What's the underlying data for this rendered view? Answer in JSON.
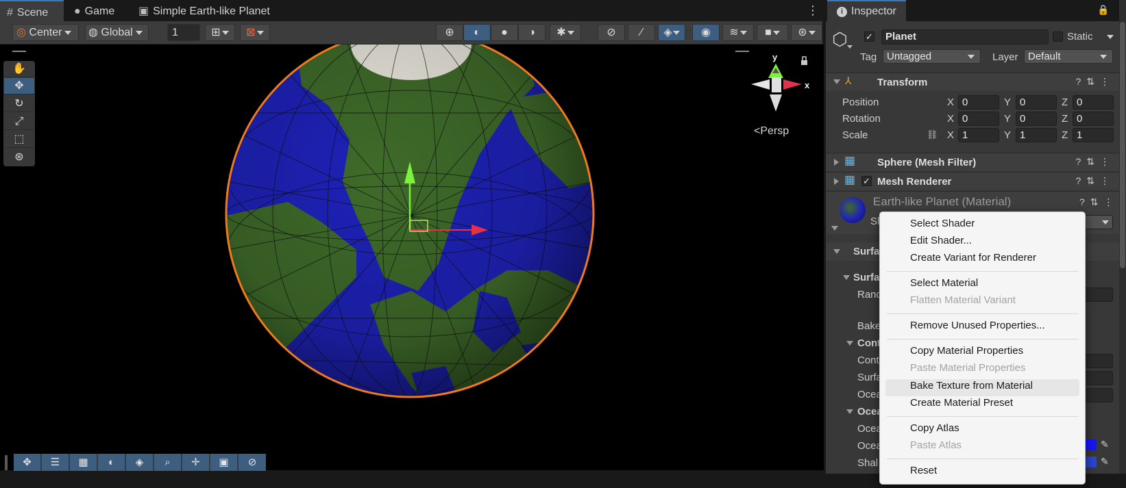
{
  "scene_tabs": {
    "scene": "Scene",
    "game": "Game",
    "document": "Simple Earth-like Planet"
  },
  "toolbar": {
    "pivot": "Center",
    "space": "Global",
    "grid_size": "1"
  },
  "viewport": {
    "gizmo_y": "y",
    "gizmo_x": "x",
    "projection": "Persp"
  },
  "inspector": {
    "tab": "Inspector",
    "object_name": "Planet",
    "static_label": "Static",
    "tag_label": "Tag",
    "tag_value": "Untagged",
    "layer_label": "Layer",
    "layer_value": "Default",
    "transform": {
      "title": "Transform",
      "position_label": "Position",
      "rotation_label": "Rotation",
      "scale_label": "Scale",
      "axis_x": "X",
      "axis_y": "Y",
      "axis_z": "Z",
      "position": [
        "0",
        "0",
        "0"
      ],
      "rotation": [
        "0",
        "0",
        "0"
      ],
      "scale": [
        "1",
        "1",
        "1"
      ]
    },
    "mesh_filter_title": "Sphere (Mesh Filter)",
    "mesh_renderer_title": "Mesh Renderer",
    "material_title": "Earth-like Planet (Material)",
    "clipped_labels": [
      "Sh",
      "Surfa",
      "Surfa",
      "Rand",
      "Bake",
      "Cont",
      "Cont",
      "Surfa",
      "Ocea",
      "Ocea",
      "Ocea",
      "Ocea",
      "Shal"
    ]
  },
  "context_menu": {
    "items": [
      {
        "label": "Select Shader",
        "enabled": true
      },
      {
        "label": "Edit Shader...",
        "enabled": true
      },
      {
        "label": "Create Variant for Renderer",
        "enabled": true
      },
      {
        "label": "Select Material",
        "enabled": true
      },
      {
        "label": "Flatten Material Variant",
        "enabled": false
      },
      {
        "label": "Remove Unused Properties...",
        "enabled": true
      },
      {
        "label": "Copy Material Properties",
        "enabled": true
      },
      {
        "label": "Paste Material Properties",
        "enabled": false
      },
      {
        "label": "Bake Texture from Material",
        "enabled": true
      },
      {
        "label": "Create Material Preset",
        "enabled": true
      },
      {
        "label": "Copy Atlas",
        "enabled": true
      },
      {
        "label": "Paste Atlas",
        "enabled": false
      },
      {
        "label": "Reset",
        "enabled": true
      }
    ]
  },
  "colors": {
    "accent": "#3a79bb",
    "active_button": "#3e5e80",
    "ocean": "#1e22b8",
    "land": "#3f6b2a",
    "selection_outline": "#f07a1c"
  }
}
